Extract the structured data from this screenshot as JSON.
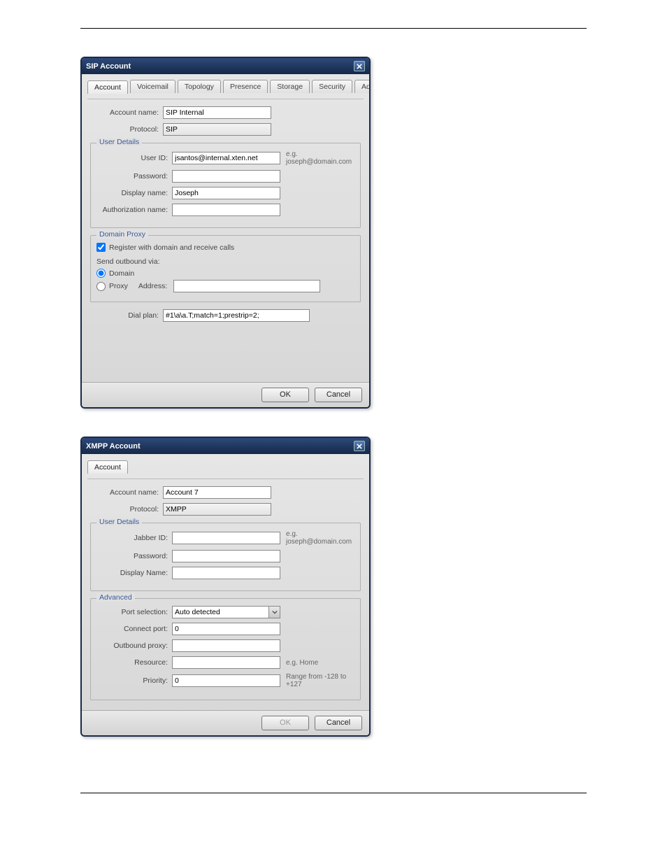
{
  "sip": {
    "title": "SIP Account",
    "tabs": [
      "Account",
      "Voicemail",
      "Topology",
      "Presence",
      "Storage",
      "Security",
      "Advanced"
    ],
    "labels": {
      "account_name": "Account name:",
      "protocol": "Protocol:",
      "user_details": "User Details",
      "user_id": "User ID:",
      "password": "Password:",
      "display_name": "Display name:",
      "auth_name": "Authorization name:",
      "domain_proxy": "Domain Proxy",
      "register": "Register with domain and receive calls",
      "send_outbound": "Send outbound via:",
      "domain": "Domain",
      "proxy": "Proxy",
      "address": "Address:",
      "dial_plan": "Dial plan:",
      "hint": "e.g. joseph@domain.com",
      "ok": "OK",
      "cancel": "Cancel"
    },
    "values": {
      "account_name": "SIP Internal",
      "protocol": "SIP",
      "user_id": "jsantos@internal.xten.net",
      "password": "",
      "display_name": "Joseph",
      "auth_name": "",
      "proxy_address": "",
      "dial_plan": "#1\\a\\a.T;match=1;prestrip=2;"
    }
  },
  "xmpp": {
    "title": "XMPP Account",
    "tabs": [
      "Account"
    ],
    "labels": {
      "account_name": "Account name:",
      "protocol": "Protocol:",
      "user_details": "User Details",
      "jabber_id": "Jabber ID:",
      "password": "Password:",
      "display_name": "Display Name:",
      "advanced": "Advanced",
      "port_selection": "Port selection:",
      "connect_port": "Connect port:",
      "outbound_proxy": "Outbound proxy:",
      "resource": "Resource:",
      "priority": "Priority:",
      "hint": "e.g. joseph@domain.com",
      "hint_resource": "e.g. Home",
      "hint_priority": "Range from -128 to +127",
      "ok": "OK",
      "cancel": "Cancel"
    },
    "values": {
      "account_name": "Account 7",
      "protocol": "XMPP",
      "jabber_id": "",
      "password": "",
      "display_name": "",
      "port_selection": "Auto detected",
      "connect_port": "0",
      "outbound_proxy": "",
      "resource": "",
      "priority": "0"
    }
  }
}
